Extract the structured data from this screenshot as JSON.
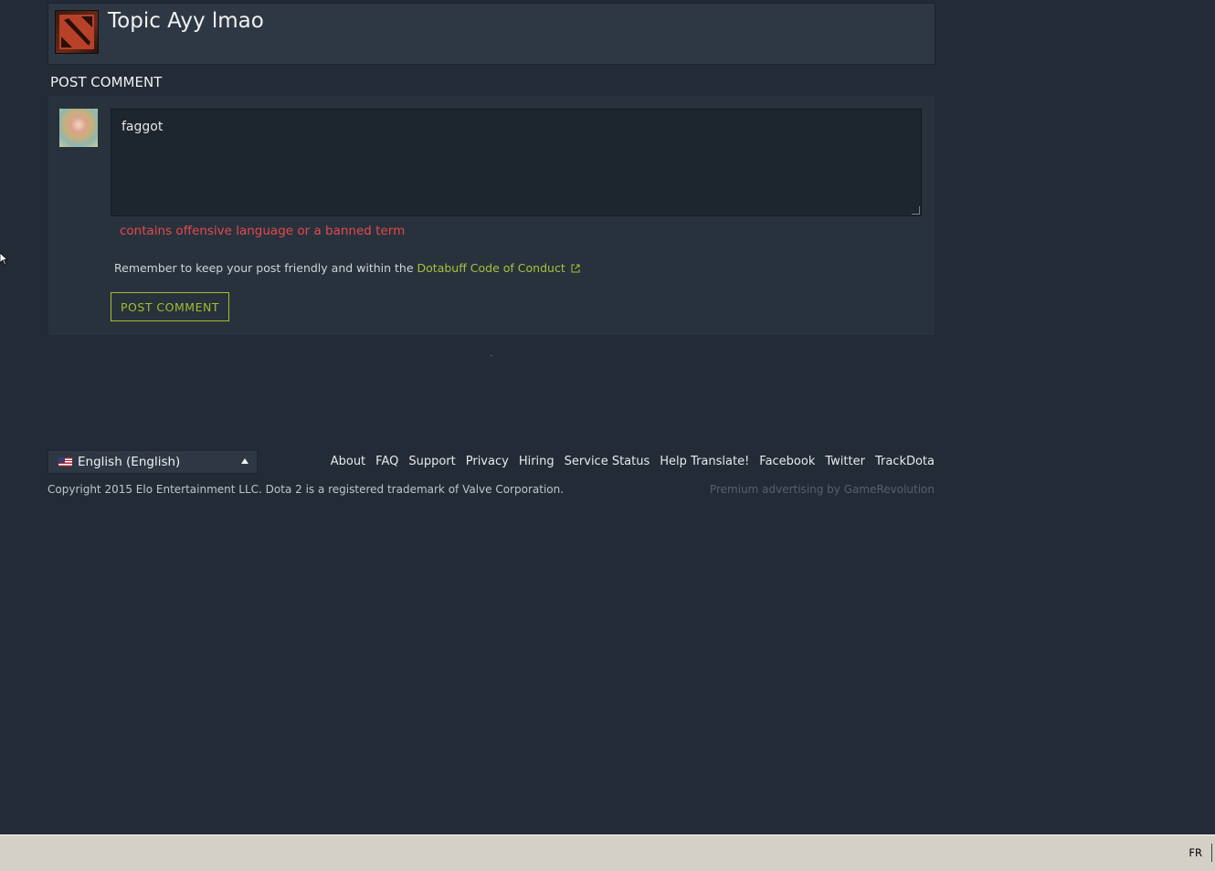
{
  "topic": {
    "title": "Topic Ayy lmao",
    "icon": "dota2-logo-icon"
  },
  "comment": {
    "heading": "POST COMMENT",
    "textarea_value": "faggot",
    "error_message": "contains offensive language or a banned term",
    "reminder_prefix": "Remember to keep your post friendly and within the ",
    "reminder_link": "Dotabuff Code of Conduct",
    "submit_label": "POST COMMENT"
  },
  "footer": {
    "language": "English (English)",
    "links": [
      "About",
      "FAQ",
      "Support",
      "Privacy",
      "Hiring",
      "Service Status",
      "Help Translate!",
      "Facebook",
      "Twitter",
      "TrackDota"
    ],
    "copyright": "Copyright 2015 Elo Entertainment LLC. Dota 2 is a registered trademark of Valve Corporation.",
    "advertising": "Premium advertising by GameRevolution"
  },
  "taskbar": {
    "language_indicator": "FR"
  },
  "colors": {
    "background": "#232b36",
    "accent": "#a6bc2c",
    "error": "#e5484d",
    "link": "#a9c13a"
  }
}
